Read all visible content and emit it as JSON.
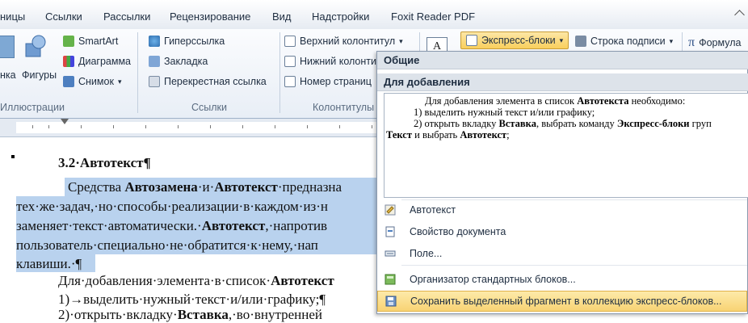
{
  "ribbon_tabs": [
    "ницы",
    "Ссылки",
    "Рассылки",
    "Рецензирование",
    "Вид",
    "Надстройки",
    "Foxit Reader PDF"
  ],
  "illustrations": {
    "smartart": "SmartArt",
    "chart": "Диаграмма",
    "screenshot": "Снимок",
    "pictures": "нка",
    "shapes": "Фигуры",
    "group_label": "Иллюстрации"
  },
  "links": {
    "hyperlink": "Гиперссылка",
    "bookmark": "Закладка",
    "cross_ref": "Перекрестная ссылка",
    "group_label": "Ссылки"
  },
  "headers": {
    "header": "Верхний колонтитул",
    "footer": "Нижний колонти",
    "page_number": "Номер страниц",
    "group_label": "Колонтитулы"
  },
  "text_group": {
    "express_blocks": "Экспресс-блоки",
    "signature_line": "Строка подписи",
    "formula": "Формула"
  },
  "dropdown": {
    "general_header": "Общие",
    "autotext_header": "Для добавления",
    "preview_lines": [
      "Для добавления элемента в список ",
      "Автотекста",
      " необходимо:",
      "1)  выделить нужный текст и/или графику;",
      "2)  открыть вкладку ",
      "Вставка",
      ", выбрать команду ",
      "Экспресс-блоки",
      " груп",
      "Текст",
      " и выбрать ",
      "Автотекст",
      ";"
    ],
    "items": [
      {
        "label": "Автотекст",
        "icon": "autotext-icon"
      },
      {
        "label": "Свойство документа",
        "icon": "doc-property-icon"
      },
      {
        "label": "Поле...",
        "icon": "field-icon"
      },
      {
        "label": "Организатор стандартных блоков...",
        "icon": "organizer-icon"
      },
      {
        "label": "Сохранить выделенный фрагмент в коллекцию экспресс-блоков...",
        "icon": "save-selection-icon"
      }
    ]
  },
  "document": {
    "heading": "3.2·Автотекст¶",
    "l1a": "Средства ",
    "l1b": "Автозамена",
    "l1c": "·и·",
    "l1d": "Автотекст",
    "l1e": "·предназна",
    "l2": "тех·же·задач,·но·способы·реализации·в·каждом·из·н",
    "l3a": "заменяет·текст·автоматически.·",
    "l3b": "Автотекст",
    "l3c": ",·напротив",
    "l4": "пользователь·специально·не·обратится·к·нему,·нап",
    "l5": "клавиши.·¶",
    "l6a": "Для·добавления·элемента·в·список·",
    "l6b": "Автотекст",
    "l7": "1)→выделить·нужный·текст·и/или·графику;¶",
    "l8a": "2)·открыть·вкладку·",
    "l8b": "Вставка",
    "l8c": ",·во·внутренней"
  }
}
